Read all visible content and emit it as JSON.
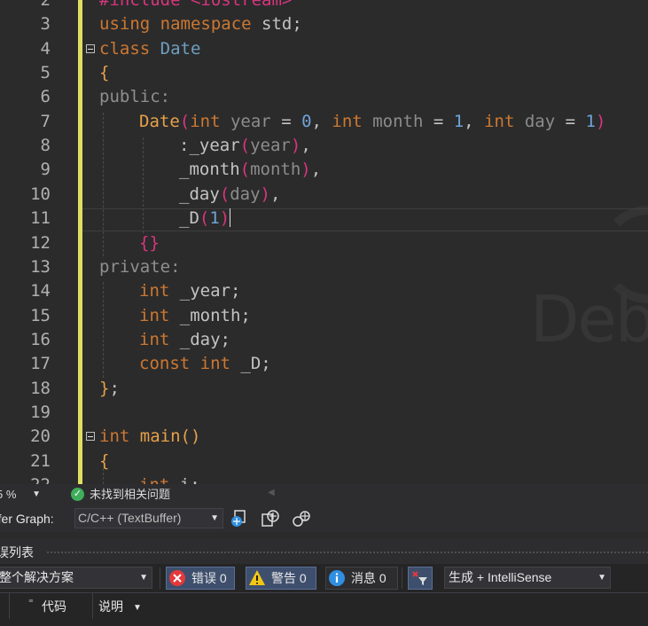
{
  "editor": {
    "lines": [
      {
        "num": "2",
        "segs": [
          [
            "pp",
            "#include "
          ],
          [
            "pp",
            "<iostream>"
          ]
        ],
        "indent": 112
      },
      {
        "num": "3",
        "segs": [
          [
            "k",
            "using "
          ],
          [
            "k",
            "namespace "
          ],
          [
            "m",
            "std;"
          ]
        ],
        "indent": 112
      },
      {
        "num": "4",
        "fold": true,
        "segs": [
          [
            "k",
            "class "
          ],
          [
            "t",
            "Date"
          ]
        ],
        "indent": 112
      },
      {
        "num": "5",
        "segs": [
          [
            "f",
            "{"
          ]
        ],
        "indent": 112
      },
      {
        "num": "6",
        "segs": [
          [
            "pu",
            "public:"
          ]
        ],
        "indent": 112
      },
      {
        "num": "7",
        "segs": [
          [
            "f",
            "Date"
          ],
          [
            "pp",
            "("
          ],
          [
            "k",
            "int "
          ],
          [
            "p",
            "year"
          ],
          [
            "m",
            " = "
          ],
          [
            "n",
            "0"
          ],
          [
            "m",
            ", "
          ],
          [
            "k",
            "int "
          ],
          [
            "p",
            "month"
          ],
          [
            "m",
            " = "
          ],
          [
            "n",
            "1"
          ],
          [
            "m",
            ", "
          ],
          [
            "k",
            "int "
          ],
          [
            "p",
            "day"
          ],
          [
            "m",
            " = "
          ],
          [
            "n",
            "1"
          ],
          [
            "pp",
            ")"
          ]
        ],
        "indent": 157
      },
      {
        "num": "8",
        "segs": [
          [
            "m",
            ":_year"
          ],
          [
            "pp",
            "("
          ],
          [
            "p",
            "year"
          ],
          [
            "pp",
            ")"
          ],
          [
            "m",
            ","
          ]
        ],
        "indent": 202
      },
      {
        "num": "9",
        "segs": [
          [
            "m",
            "_month"
          ],
          [
            "pp",
            "("
          ],
          [
            "p",
            "month"
          ],
          [
            "pp",
            ")"
          ],
          [
            "m",
            ","
          ]
        ],
        "indent": 202
      },
      {
        "num": "10",
        "segs": [
          [
            "m",
            "_day"
          ],
          [
            "pp",
            "("
          ],
          [
            "p",
            "day"
          ],
          [
            "pp",
            ")"
          ],
          [
            "m",
            ","
          ]
        ],
        "indent": 202
      },
      {
        "num": "11",
        "segs": [
          [
            "m",
            "_D"
          ],
          [
            "pp",
            "("
          ],
          [
            "n",
            "1"
          ],
          [
            "pp",
            ")"
          ]
        ],
        "indent": 202,
        "cursor": true
      },
      {
        "num": "12",
        "segs": [
          [
            "pp",
            "{}"
          ]
        ],
        "indent": 157
      },
      {
        "num": "13",
        "segs": [
          [
            "pu",
            "private:"
          ]
        ],
        "indent": 112
      },
      {
        "num": "14",
        "segs": [
          [
            "k",
            "int "
          ],
          [
            "m",
            "_year;"
          ]
        ],
        "indent": 157
      },
      {
        "num": "15",
        "segs": [
          [
            "k",
            "int "
          ],
          [
            "m",
            "_month;"
          ]
        ],
        "indent": 157
      },
      {
        "num": "16",
        "segs": [
          [
            "k",
            "int "
          ],
          [
            "m",
            "_day;"
          ]
        ],
        "indent": 157
      },
      {
        "num": "17",
        "segs": [
          [
            "k",
            "const "
          ],
          [
            "k",
            "int "
          ],
          [
            "m",
            "_D;"
          ]
        ],
        "indent": 157
      },
      {
        "num": "18",
        "segs": [
          [
            "f",
            "}"
          ],
          [
            "m",
            ";"
          ]
        ],
        "indent": 112
      },
      {
        "num": "19",
        "segs": [],
        "indent": 112
      },
      {
        "num": "20",
        "fold": true,
        "segs": [
          [
            "k",
            "int "
          ],
          [
            "f",
            "main"
          ],
          [
            "f",
            "()"
          ]
        ],
        "indent": 112
      },
      {
        "num": "21",
        "segs": [
          [
            "f",
            "{"
          ]
        ],
        "indent": 112
      },
      {
        "num": "22",
        "segs": [
          [
            "k",
            "int "
          ],
          [
            "m",
            "i;"
          ]
        ],
        "indent": 157
      }
    ],
    "watermark": "Deb"
  },
  "status": {
    "zoom": "5 %",
    "issues_text": "未找到相关问题"
  },
  "buffer_bar": {
    "label": "ffer Graph:",
    "selected": "C/C++ (TextBuffer)"
  },
  "error_panel": {
    "title": "误列表",
    "scope": "整个解决方案",
    "errors_label": "错误 0",
    "warnings_label": "警告 0",
    "messages_label": "消息 0",
    "build_filter": "生成 + IntelliSense",
    "columns": {
      "code": "代码",
      "description": "说明"
    }
  },
  "colors": {
    "error": "#e5383b",
    "warning": "#f3c515",
    "info": "#2f8fe0",
    "ok": "#3fae5a"
  }
}
